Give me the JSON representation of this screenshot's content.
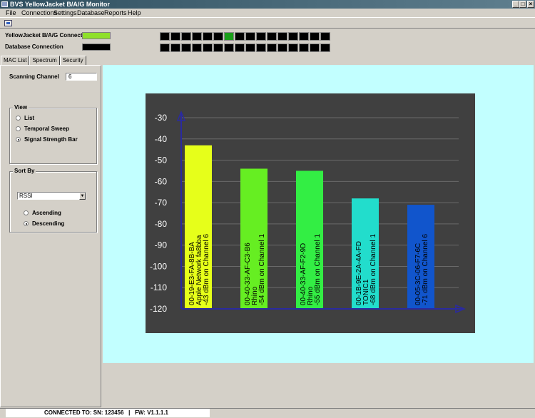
{
  "window": {
    "title": "BVS YellowJacket B/A/G Monitor",
    "controls": {
      "minimize": "_",
      "maximize": "□",
      "close": "×"
    }
  },
  "menu": [
    "File",
    "Connections",
    "Settings",
    "Database",
    "Reports",
    "Help"
  ],
  "status": {
    "yj_label": "YellowJacket B/A/G Connection",
    "yj_color": "#8fe02a",
    "db_label": "Database Connection",
    "db_color": "#000000",
    "led_row1": [
      "#000000",
      "#000000",
      "#000000",
      "#000000",
      "#000000",
      "#000000",
      "#1a9f1a",
      "#000000",
      "#000000",
      "#000000",
      "#000000",
      "#000000",
      "#000000",
      "#000000",
      "#000000",
      "#000000"
    ],
    "led_row2": [
      "#000000",
      "#000000",
      "#000000",
      "#000000",
      "#000000",
      "#000000",
      "#000000",
      "#000000",
      "#000000",
      "#000000",
      "#000000",
      "#000000",
      "#000000",
      "#000000",
      "#000000",
      "#000000"
    ]
  },
  "tabs": [
    "MAC List",
    "Spectrum",
    "Security"
  ],
  "left": {
    "scan_label": "Scanning Channel",
    "scan_value": "6",
    "view_title": "View",
    "view_options": [
      "List",
      "Temporal Sweep",
      "Signal Strength Bar"
    ],
    "view_selected": 2,
    "sort_title": "Sort By",
    "sort_value": "RSSI",
    "sort_options": [
      "Ascending",
      "Descending"
    ],
    "sort_selected": 1
  },
  "statusbar": {
    "text": "CONNECTED TO: SN: 123456   |   FW: V1.1.1.1"
  },
  "colors": {
    "background": "#c2ffff",
    "chart_bg": "#404040",
    "axis": "#2a2aa0"
  },
  "chart_data": {
    "type": "bar",
    "ylim": [
      -120,
      -30
    ],
    "yticks": [
      -30,
      -40,
      -50,
      -60,
      -70,
      -80,
      -90,
      -100,
      -110,
      -120
    ],
    "grid": true,
    "bars": [
      {
        "lines": [
          "00-19-E3-FA-8B-BA",
          "Apple Network fa8bba",
          "-43 dBm on Channel 6"
        ],
        "value": -43,
        "color": "#e6ff1a"
      },
      {
        "lines": [
          "00-40-33-AF-C3-B6",
          "Rhino",
          "-54 dBm on Channel 1"
        ],
        "value": -54,
        "color": "#66ee22"
      },
      {
        "lines": [
          "00-40-33-AF-F2-9D",
          "Rhino",
          "-55 dBm on Channel 1"
        ],
        "value": -55,
        "color": "#33ee44"
      },
      {
        "lines": [
          "00-1B-9E-2A-4A-FD",
          "TONIC1",
          "-68 dBm on Channel 1"
        ],
        "value": -68,
        "color": "#22ddcc"
      },
      {
        "lines": [
          "00-05-3C-06-F7-6C",
          "-71 dBm on Channel 6"
        ],
        "value": -71,
        "color": "#1155cc"
      }
    ]
  }
}
